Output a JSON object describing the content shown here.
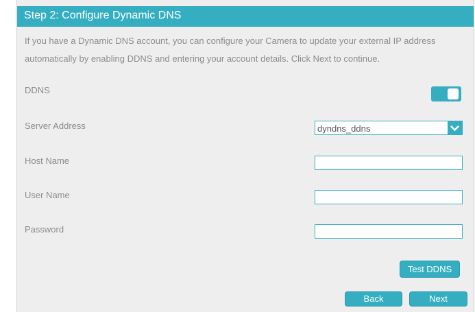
{
  "header": {
    "title": "Step 2: Configure Dynamic DNS"
  },
  "intro": "If you have a Dynamic DNS account, you can configure your Camera to update your external IP address automatically by enabling DDNS and entering your account details. Click Next to continue.",
  "fields": {
    "ddns_label": "DDNS",
    "ddns_enabled": true,
    "server_label": "Server Address",
    "server_value": "dyndns_ddns",
    "host_label": "Host Name",
    "host_value": "",
    "user_label": "User Name",
    "user_value": "",
    "password_label": "Password",
    "password_value": ""
  },
  "buttons": {
    "test": "Test DDNS",
    "back": "Back",
    "next": "Next"
  },
  "colors": {
    "accent": "#35aec2",
    "panel_bg": "#eeeeee",
    "text_muted": "#8c8c8c"
  }
}
